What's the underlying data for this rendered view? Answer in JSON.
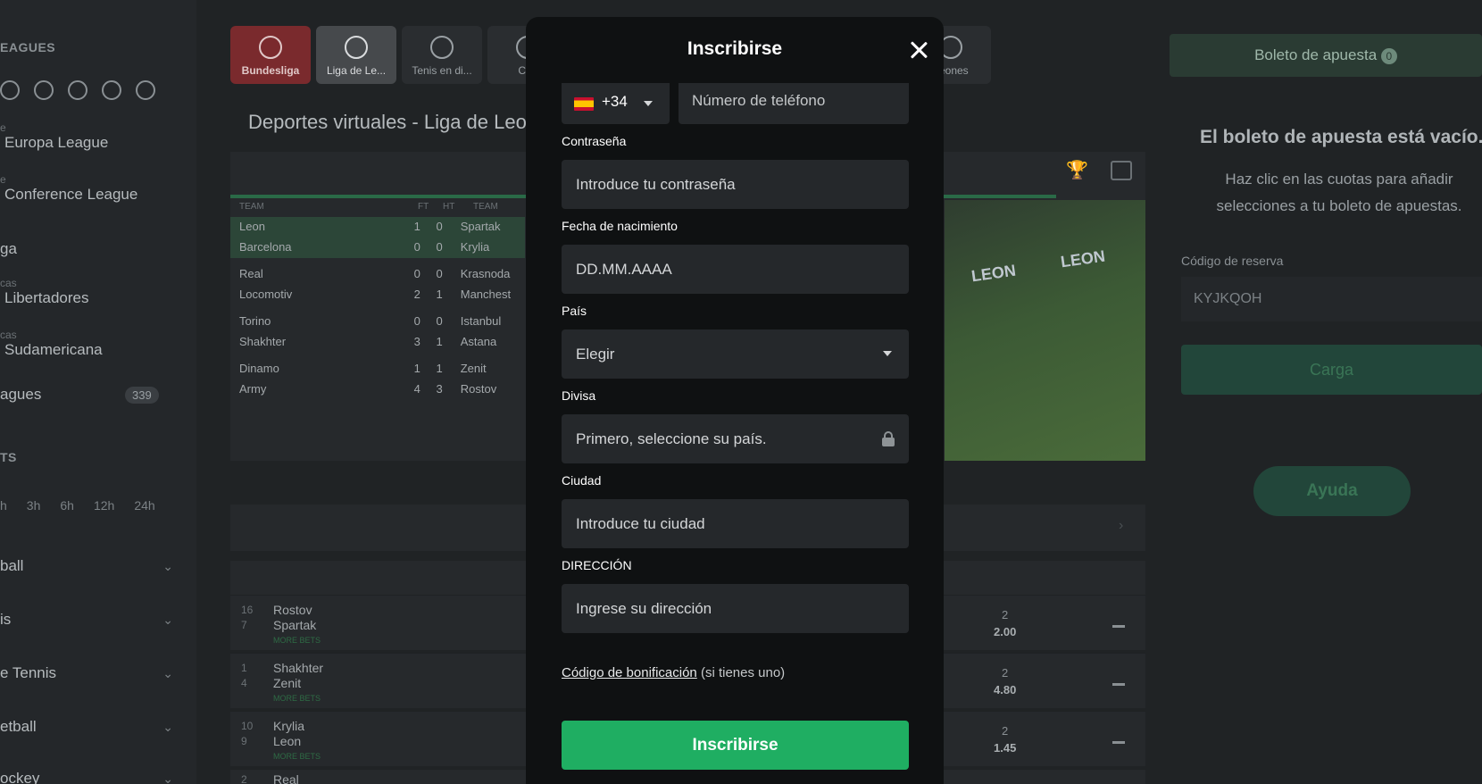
{
  "background": {
    "sidebar": {
      "section_title": "EAGUES",
      "leagues": [
        {
          "small": "e",
          "big": "Europa League"
        },
        {
          "small": "e",
          "big": "Conference League"
        },
        {
          "small": "",
          "big": "ga"
        },
        {
          "small": "cas",
          "big": "Libertadores"
        },
        {
          "small": "cas",
          "big": "Sudamericana"
        },
        {
          "small": "",
          "big": "agues"
        }
      ],
      "leagues_count": "339",
      "time_filters_title": "TS",
      "time_filters": [
        "h",
        "3h",
        "6h",
        "12h",
        "24h"
      ],
      "sports": [
        "ball",
        "is",
        "e Tennis",
        "etball",
        "ockey"
      ]
    },
    "top_tabs": [
      {
        "label": "Bundesliga",
        "icon": "bundesliga-icon"
      },
      {
        "label": "Liga de Le...",
        "icon": "soccer-ball-icon"
      },
      {
        "label": "Tenis en di...",
        "icon": "tennis-ball-icon"
      },
      {
        "label": "Cric",
        "icon": "cricket-icon"
      },
      {
        "label": "peones",
        "icon": "soccer-ball-icon"
      }
    ],
    "page_heading": "Deportes virtuales - Liga de Leo",
    "scoreboard": {
      "headers": {
        "team": "TEAM",
        "ft": "FT",
        "ht": "HT",
        "team2": "TEAM"
      },
      "groups": [
        [
          {
            "t1": "Leon",
            "ft": "1",
            "ht": "0",
            "t2": "Spartak"
          },
          {
            "t1": "Barcelona",
            "ft": "0",
            "ht": "0",
            "t2": "Krylia"
          }
        ],
        [
          {
            "t1": "Real",
            "ft": "0",
            "ht": "0",
            "t2": "Krasnoda"
          },
          {
            "t1": "Locomotiv",
            "ft": "2",
            "ht": "1",
            "t2": "Manchest"
          }
        ],
        [
          {
            "t1": "Torino",
            "ft": "0",
            "ht": "0",
            "t2": "Istanbul"
          },
          {
            "t1": "Shakhter",
            "ft": "3",
            "ht": "1",
            "t2": "Astana"
          }
        ],
        [
          {
            "t1": "Dinamo",
            "ft": "1",
            "ht": "1",
            "t2": "Zenit"
          },
          {
            "t1": "Army",
            "ft": "4",
            "ht": "3",
            "t2": "Rostov"
          }
        ]
      ]
    },
    "video": {
      "logo1": "LEON",
      "logo2": "LEON"
    },
    "matches": [
      {
        "n1": "16",
        "n2": "7",
        "t1": "Rostov",
        "t2": "Spartak",
        "more": "MORE BETS",
        "odd_label": "2",
        "odd": "2.00"
      },
      {
        "n1": "1",
        "n2": "4",
        "t1": "Shakhter",
        "t2": "Zenit",
        "more": "MORE BETS",
        "odd_label": "2",
        "odd": "4.80"
      },
      {
        "n1": "10",
        "n2": "9",
        "t1": "Krylia",
        "t2": "Leon",
        "more": "MORE BETS",
        "odd_label": "2",
        "odd": "1.45"
      },
      {
        "n1": "2",
        "n2": "",
        "t1": "Real",
        "t2": "",
        "more": "",
        "odd_label": "",
        "odd": ""
      }
    ],
    "betslip": {
      "title": "Boleto de apuesta",
      "count": "0",
      "empty_title": "El boleto de apuesta está vacío.",
      "empty_sub": "Haz clic en las cuotas para añadir selecciones a tu boleto de apuestas.",
      "reservation_label": "Código de reserva",
      "reservation_value": "KYJKQOH",
      "load_button": "Carga",
      "help_button": "Ayuda"
    }
  },
  "modal": {
    "title": "Inscribirse",
    "phone": {
      "country_code": "+34",
      "placeholder": "Número de teléfono"
    },
    "password": {
      "label": "Contraseña",
      "placeholder": "Introduce tu contraseña"
    },
    "birthdate": {
      "label": "Fecha de nacimiento",
      "placeholder": "DD.MM.AAAA"
    },
    "country": {
      "label": "País",
      "value": "Elegir"
    },
    "currency": {
      "label": "Divisa",
      "value": "Primero, seleccione su país."
    },
    "city": {
      "label": "Ciudad",
      "placeholder": "Introduce tu ciudad"
    },
    "address": {
      "label": "DIRECCIÓN",
      "placeholder": "Ingrese su dirección"
    },
    "bonus": {
      "link": "Código de bonificación",
      "suffix": " (si tienes uno)"
    },
    "submit": "Inscribirse"
  },
  "colors": {
    "accent_green": "#1fae62",
    "modal_bg": "#0f1112",
    "field_bg": "#25282b"
  }
}
